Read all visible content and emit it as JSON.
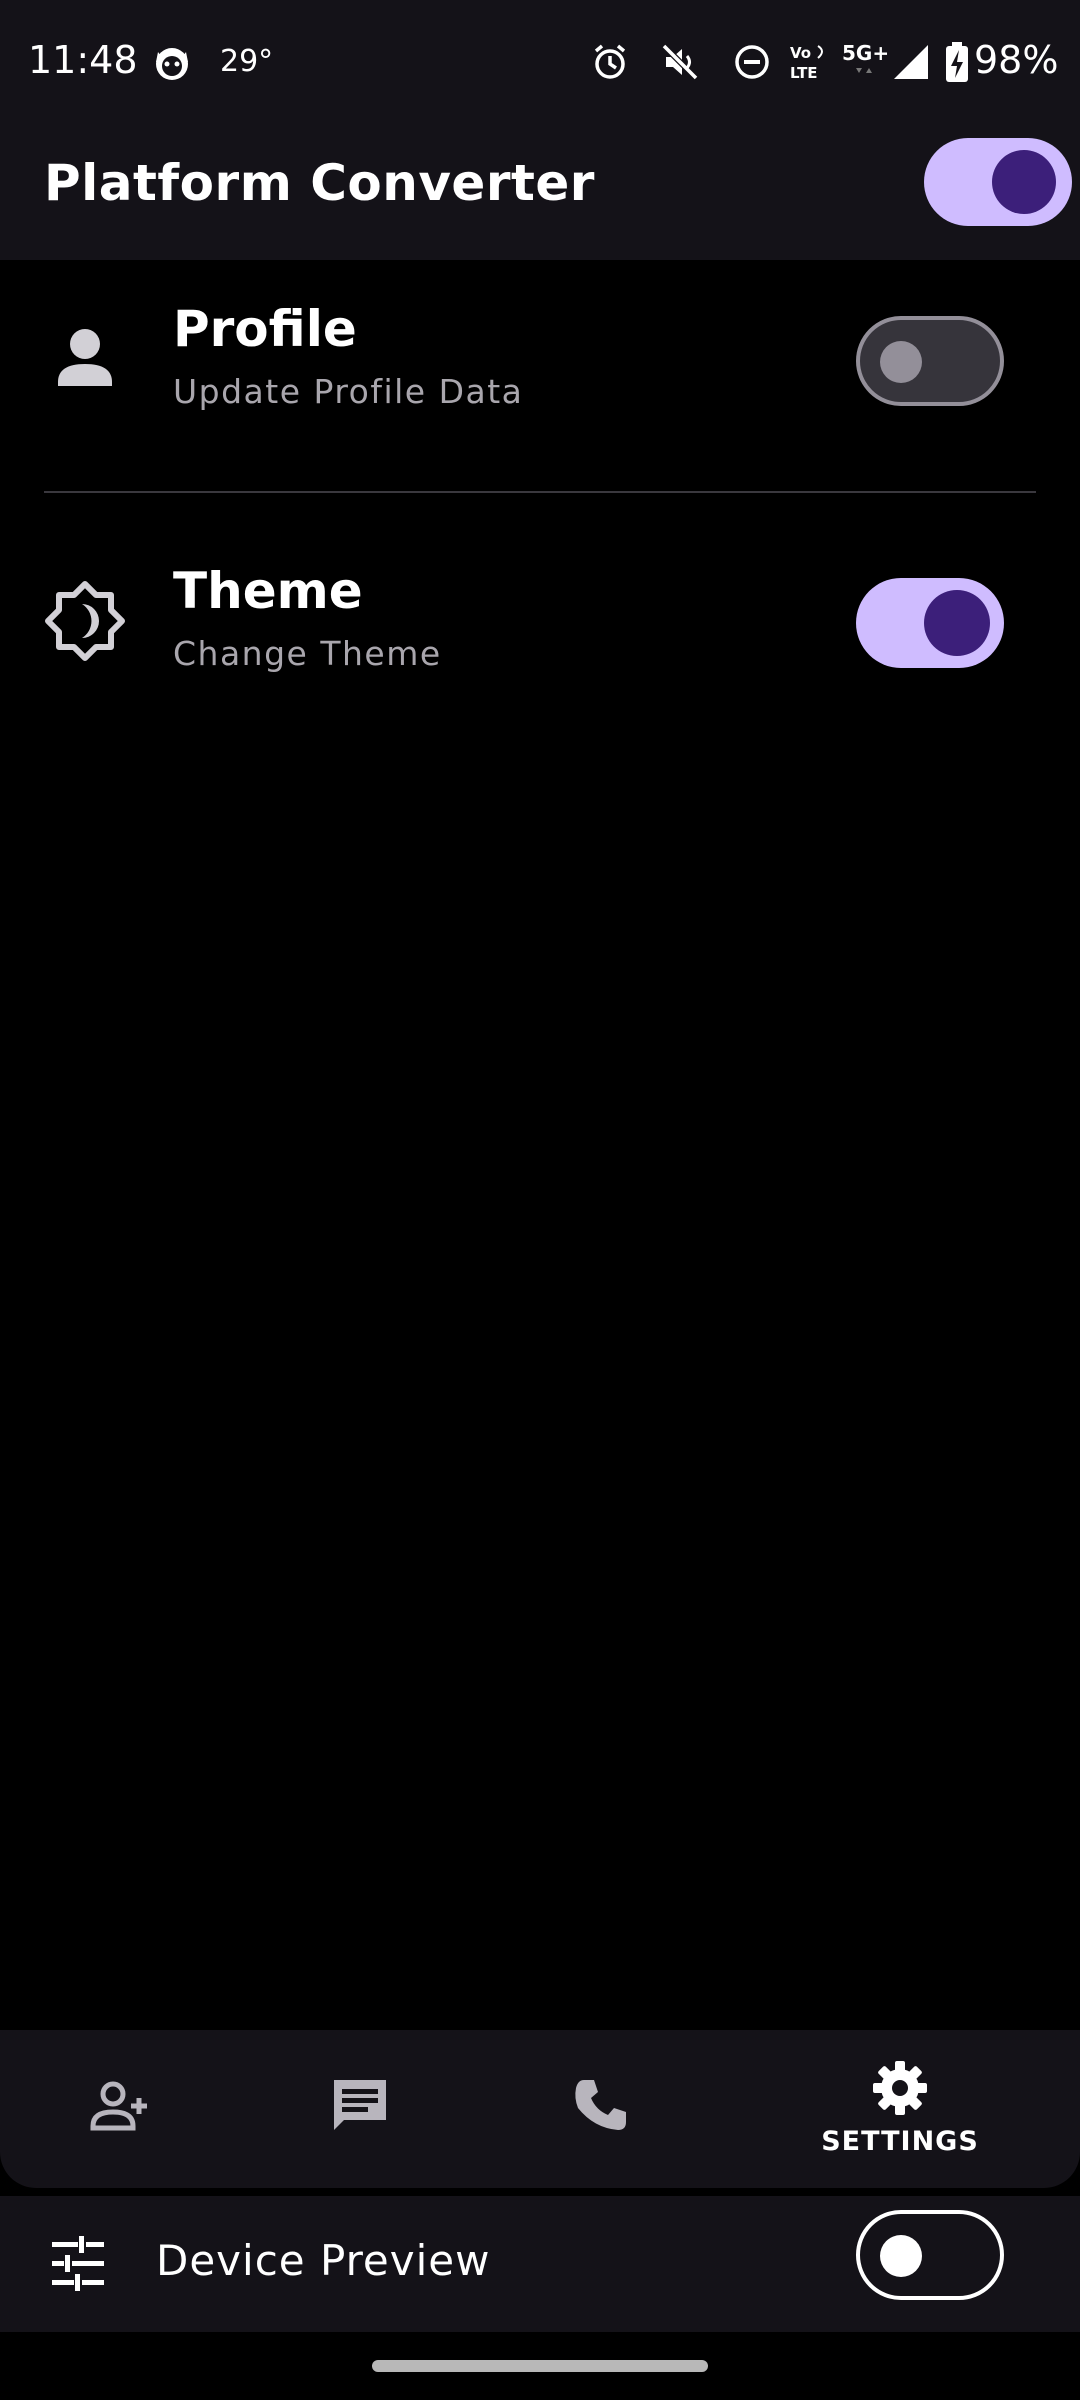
{
  "status_bar": {
    "time": "11:48",
    "temperature": "29°",
    "battery": "98%",
    "icons": [
      "cat-face-icon",
      "alarm-icon",
      "mute-icon",
      "do-not-disturb-icon",
      "volte-icon",
      "5g-plus-icon",
      "signal-icon",
      "battery-charging-icon"
    ]
  },
  "appbar": {
    "title": "Platform Converter",
    "toggle_on": true
  },
  "settings": [
    {
      "title": "Profile",
      "subtitle": "Update Profile Data",
      "icon": "person-icon",
      "enabled": false
    },
    {
      "title": "Theme",
      "subtitle": "Change Theme",
      "icon": "brightness-moon-icon",
      "enabled": true
    }
  ],
  "bottom_nav": {
    "items": [
      {
        "icon": "add-person-icon",
        "label": ""
      },
      {
        "icon": "chat-icon",
        "label": ""
      },
      {
        "icon": "phone-icon",
        "label": ""
      },
      {
        "icon": "settings-icon",
        "label": "SETTINGS",
        "selected": true
      }
    ]
  },
  "device_preview": {
    "label": "Device Preview",
    "enabled": false
  },
  "colors": {
    "surface": "#141218",
    "background": "#000000",
    "accent": "#cfbcff",
    "accent_dark": "#3c1f7a",
    "subtitle": "#a9a6ad"
  }
}
